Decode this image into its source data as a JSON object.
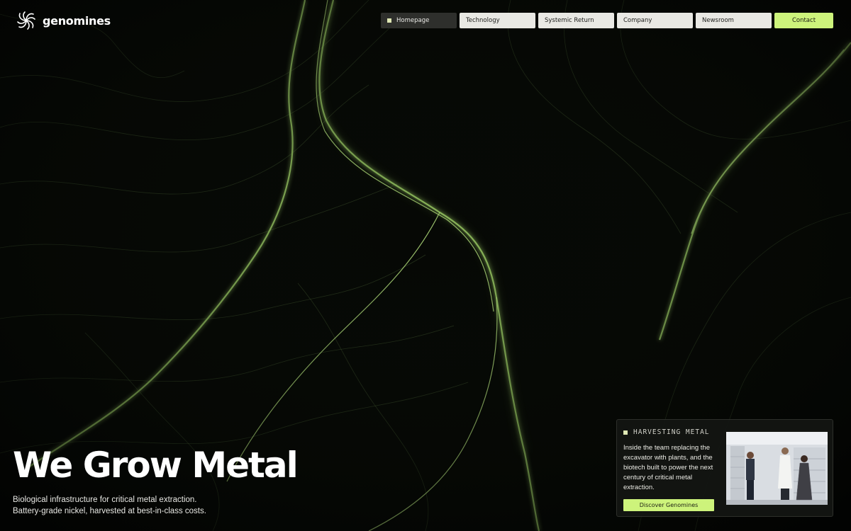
{
  "brand": {
    "name": "genomines",
    "logo_icon": "spiral-flower-icon"
  },
  "nav": {
    "items": [
      {
        "label": "Homepage",
        "active": true
      },
      {
        "label": "Technology",
        "active": false
      },
      {
        "label": "Systemic Return",
        "active": false
      },
      {
        "label": "Company",
        "active": false
      },
      {
        "label": "Newsroom",
        "active": false
      }
    ],
    "contact_label": "Contact"
  },
  "hero": {
    "title": "We Grow Metal",
    "subtitle_line1": "Biological infrastructure for critical metal extraction.",
    "subtitle_line2": "Battery-grade nickel, harvested at best-in-class costs."
  },
  "card": {
    "label": "HARVESTING METAL",
    "text": "Inside the team replacing the excavator with plants, and the biotech built to power the next century of critical metal extraction.",
    "button_label": "Discover Genomines"
  },
  "colors": {
    "accent": "#cdf37b",
    "background": "#050604",
    "strands": "#9ec86a"
  }
}
